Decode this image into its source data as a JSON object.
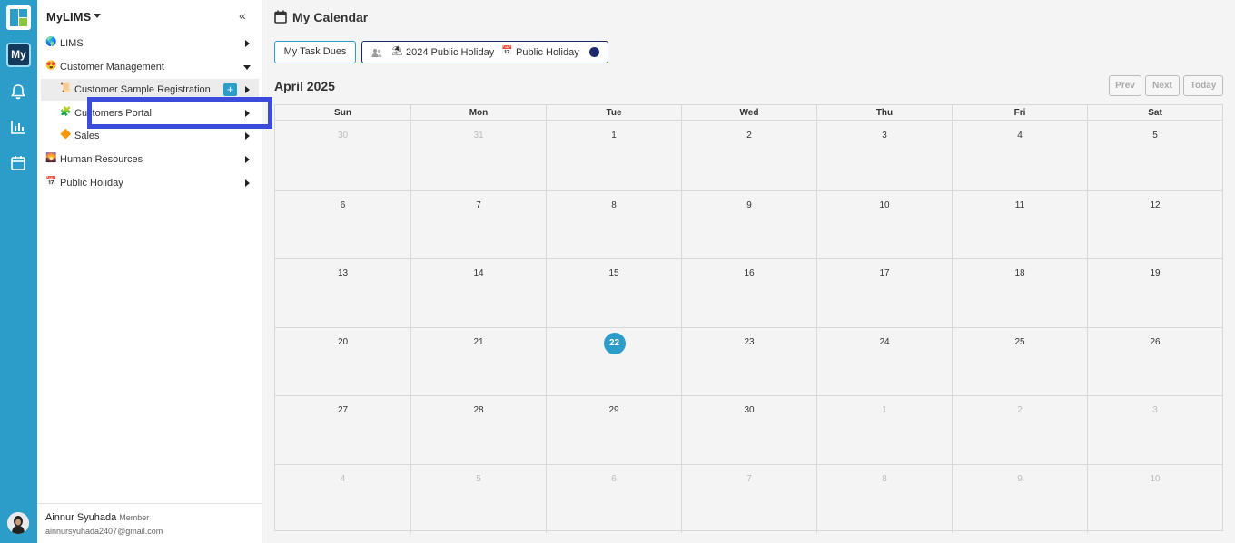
{
  "rail": {
    "my_label": "My"
  },
  "sidebar": {
    "title": "MyLIMS",
    "collapse_glyph": "«",
    "items": [
      {
        "label": "LIMS",
        "icon": "globe-icon",
        "emoji": "🌎",
        "level": 0,
        "caret": "right"
      },
      {
        "label": "Customer Management",
        "icon": "smiley-icon",
        "emoji": "😍",
        "level": 0,
        "caret": "down"
      },
      {
        "label": "Customer Sample Registration",
        "icon": "scroll-icon",
        "emoji": "📜",
        "level": 1,
        "caret": "right",
        "add": "+",
        "active": true
      },
      {
        "label": "Customers Portal",
        "icon": "puzzle-icon",
        "emoji": "🧩",
        "level": 1,
        "caret": "right"
      },
      {
        "label": "Sales",
        "icon": "diamond-icon",
        "emoji": "🔶",
        "level": 1,
        "caret": "right"
      },
      {
        "label": "Human Resources",
        "icon": "sunrise-icon",
        "emoji": "🌄",
        "level": 0,
        "caret": "right"
      },
      {
        "label": "Public Holiday",
        "icon": "calendar-icon",
        "emoji": "📅",
        "level": 0,
        "caret": "right"
      }
    ],
    "user": {
      "name": "Ainnur Syuhada",
      "role": "Member",
      "email": "ainnursyuhada2407@gmail.com"
    }
  },
  "main": {
    "title": "My Calendar",
    "task_dues_label": "My Task Dues",
    "filters": [
      {
        "label": "2024 Public Holiday",
        "emoji": "⛱",
        "icon": "beach-umbrella-icon"
      },
      {
        "label": "Public Holiday",
        "emoji": "📅",
        "icon": "calendar-icon"
      }
    ],
    "filter_dot_color": "#1c2a6b",
    "month": "April 2025",
    "nav": {
      "prev": "Prev",
      "next": "Next",
      "today": "Today"
    },
    "weekdays": [
      "Sun",
      "Mon",
      "Tue",
      "Wed",
      "Thu",
      "Fri",
      "Sat"
    ],
    "weeks": [
      [
        {
          "d": "30",
          "m": true
        },
        {
          "d": "31",
          "m": true
        },
        {
          "d": "1"
        },
        {
          "d": "2"
        },
        {
          "d": "3"
        },
        {
          "d": "4"
        },
        {
          "d": "5"
        }
      ],
      [
        {
          "d": "6"
        },
        {
          "d": "7"
        },
        {
          "d": "8"
        },
        {
          "d": "9"
        },
        {
          "d": "10"
        },
        {
          "d": "11"
        },
        {
          "d": "12"
        }
      ],
      [
        {
          "d": "13"
        },
        {
          "d": "14"
        },
        {
          "d": "15"
        },
        {
          "d": "16"
        },
        {
          "d": "17"
        },
        {
          "d": "18"
        },
        {
          "d": "19"
        }
      ],
      [
        {
          "d": "20"
        },
        {
          "d": "21"
        },
        {
          "d": "22",
          "today": true
        },
        {
          "d": "23"
        },
        {
          "d": "24"
        },
        {
          "d": "25"
        },
        {
          "d": "26"
        }
      ],
      [
        {
          "d": "27"
        },
        {
          "d": "28"
        },
        {
          "d": "29"
        },
        {
          "d": "30"
        },
        {
          "d": "1",
          "m": true
        },
        {
          "d": "2",
          "m": true
        },
        {
          "d": "3",
          "m": true
        }
      ],
      [
        {
          "d": "4",
          "m": true
        },
        {
          "d": "5",
          "m": true
        },
        {
          "d": "6",
          "m": true
        },
        {
          "d": "7",
          "m": true
        },
        {
          "d": "8",
          "m": true
        },
        {
          "d": "9",
          "m": true
        },
        {
          "d": "10",
          "m": true
        }
      ]
    ],
    "accent_color": "#2c9cc9"
  }
}
